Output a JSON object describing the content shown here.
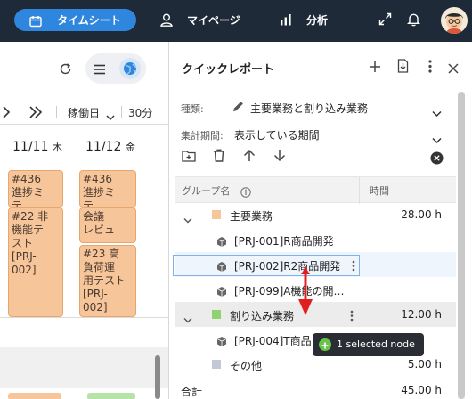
{
  "topbar": {
    "tabs": [
      {
        "label": "タイムシート",
        "icon": "calendar-icon",
        "active": true
      },
      {
        "label": "マイページ",
        "icon": "user-icon",
        "active": false
      },
      {
        "label": "分析",
        "icon": "bar-chart-icon",
        "active": false
      }
    ],
    "icons": [
      "expand-icon",
      "bell-icon",
      "avatar"
    ]
  },
  "calendar": {
    "nav": {
      "prev": "‹",
      "next": "»",
      "view_mode": "稼働日",
      "interval": "30分"
    },
    "days": [
      {
        "date": "11/11",
        "weekday": "木"
      },
      {
        "date": "11/12",
        "weekday": "金"
      }
    ],
    "events_col1": [
      {
        "text": "#436\n進捗ミ\nテ…"
      },
      {
        "text": "#22 非\n機能テ\nスト\n[PRJ-\n002]"
      }
    ],
    "events_col2": [
      {
        "text": "#436\n進捗ミ\nテ…"
      },
      {
        "text": "会議\nレビュ"
      },
      {
        "text": "#23 高\n負荷運\n用テスト\n[PRJ-\n002]"
      }
    ]
  },
  "panel": {
    "title": "クイックレポート",
    "type_label": "種類:",
    "type_value": "主要業務と割り込み業務",
    "period_label": "集計期間:",
    "period_value": "表示している期間",
    "grid": {
      "col_group": "グループ名",
      "col_time": "時間"
    },
    "rows": [
      {
        "label": "主要業務",
        "hours": "28.00 h",
        "kind": "group",
        "color": "#f7c59a"
      },
      {
        "label": "[PRJ-001]R商品開発",
        "hours": "",
        "kind": "item"
      },
      {
        "label": "[PRJ-002]R2商品開発",
        "hours": "",
        "kind": "item",
        "selected": true
      },
      {
        "label": "[PRJ-099]A機能の開…",
        "hours": "",
        "kind": "item"
      },
      {
        "label": "割り込み業務",
        "hours": "12.00 h",
        "kind": "group",
        "color": "#8fd26f"
      },
      {
        "label": "[PRJ-004]T商品",
        "hours": "",
        "kind": "item"
      },
      {
        "label": "その他",
        "hours": "5.00 h",
        "kind": "other",
        "color": "#c4c8d6"
      }
    ],
    "total_label": "合計",
    "total_hours": "45.00 h",
    "drag_tooltip": "1 selected node"
  },
  "colors": {
    "topbar_bg": "#1e2a38",
    "accent": "#2f86de",
    "event_orange": "#f7c59a",
    "interrupt_green": "#8fd26f",
    "drag_arrow": "#e02020"
  }
}
